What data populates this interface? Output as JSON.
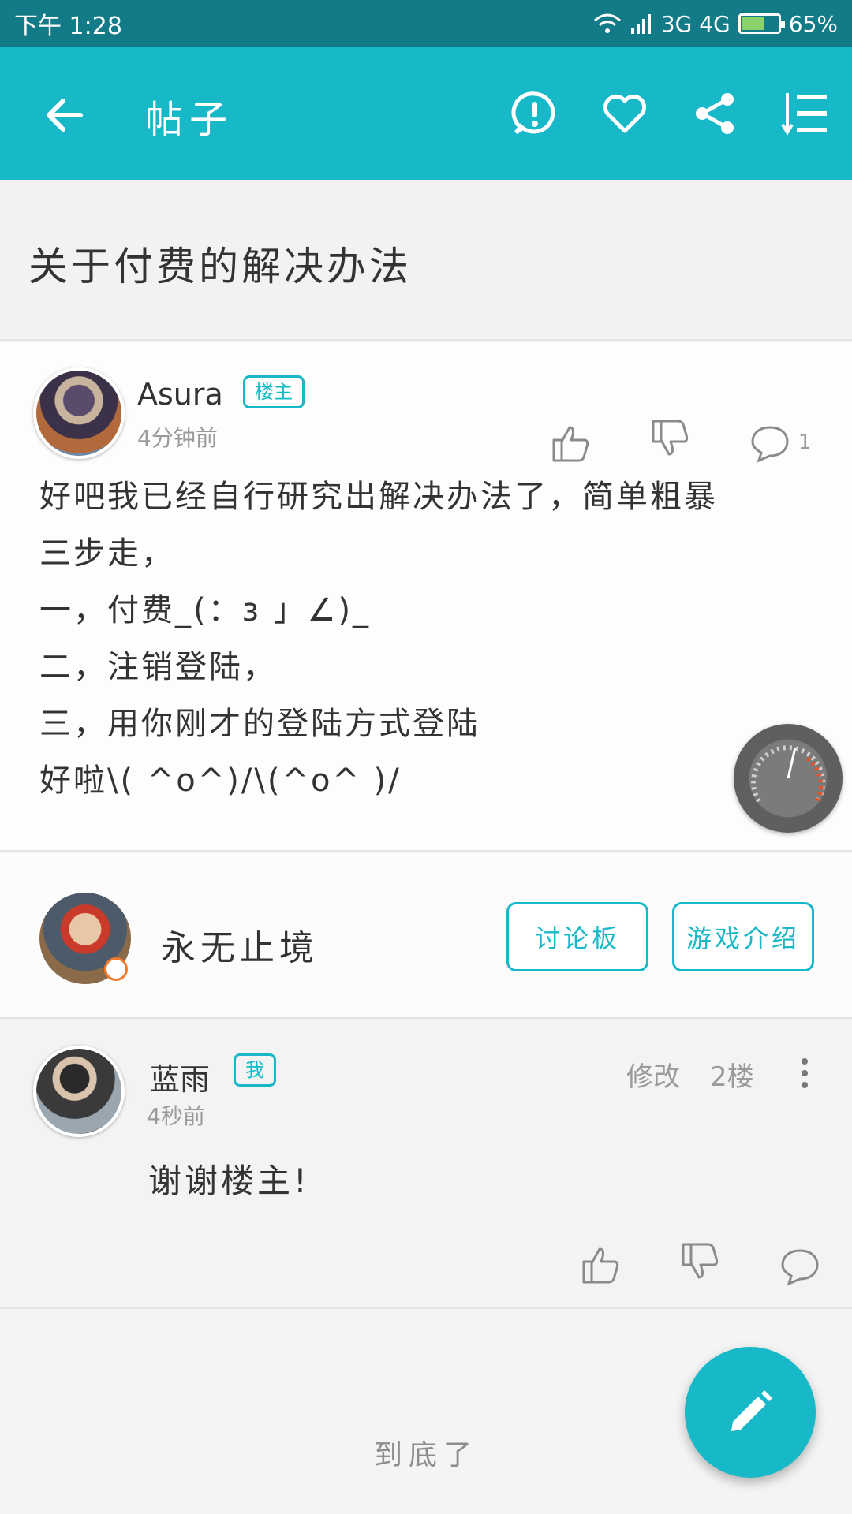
{
  "status_bar": {
    "time": "下午 1:28",
    "network": "3G 4G",
    "battery": "65%"
  },
  "app_bar": {
    "title": "帖子",
    "icons": [
      "back-arrow-icon",
      "report-icon",
      "favorite-icon",
      "share-icon",
      "sort-list-icon"
    ]
  },
  "post": {
    "title": "关于付费的解决办法",
    "author": "Asura",
    "author_tag": "楼主",
    "time": "4分钟前",
    "comment_count": "1",
    "body_lines": [
      "好吧我已经自行研究出解决办法了，简单粗暴",
      "三步走，",
      "一，付费_(：з 」∠)_",
      "二，注销登陆，",
      "三，用你刚才的登陆方式登陆",
      "好啦\\( ^o^)/\\(^o^ )/"
    ]
  },
  "game": {
    "name": "永无止境",
    "discussion_button": "讨论板",
    "intro_button": "游戏介绍"
  },
  "reply": {
    "author": "蓝雨",
    "author_tag": "我",
    "time": "4秒前",
    "edit_label": "修改",
    "floor": "2楼",
    "content": "谢谢楼主!"
  },
  "footer": {
    "end_text": "到底了"
  },
  "colors": {
    "accent": "#17b8c8",
    "status_bar": "#137a87"
  }
}
